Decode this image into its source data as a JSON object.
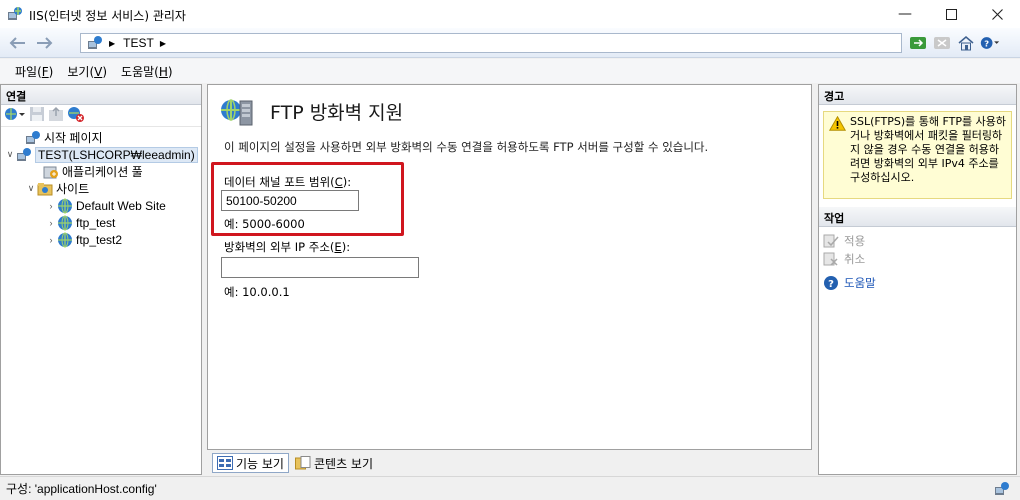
{
  "window": {
    "title": "IIS(인터넷 정보 서비스) 관리자"
  },
  "address": {
    "segments": [
      "TEST"
    ]
  },
  "menu": {
    "items": [
      {
        "label": "파일(",
        "key": "F",
        "end": ")"
      },
      {
        "label": "보기(",
        "key": "V",
        "end": ")"
      },
      {
        "label": "도움말(",
        "key": "H",
        "end": ")"
      }
    ]
  },
  "connections": {
    "header": "연결",
    "tree": [
      {
        "label": "시작 페이지"
      },
      {
        "label": "TEST(LSHCORP₩leeadmin)"
      },
      {
        "label": "애플리케이션 풀"
      },
      {
        "label": "사이트"
      },
      {
        "label": "Default Web Site"
      },
      {
        "label": "ftp_test"
      },
      {
        "label": "ftp_test2"
      }
    ]
  },
  "main": {
    "title": "FTP 방화벽 지원",
    "description": "이 페이지의 설정을 사용하면 외부 방화벽의 수동 연결을 허용하도록 FTP 서버를 구성할 수 있습니다.",
    "port_range": {
      "label": "데이터 채널 포트 범위(",
      "key": "C",
      "end": "):",
      "value": "50100-50200",
      "example": "예: 5000-6000"
    },
    "external_ip": {
      "label": "방화벽의 외부 IP 주소(",
      "key": "E",
      "end": "):",
      "value": "",
      "example": "예: 10.0.0.1"
    }
  },
  "tabs": {
    "features": "기능 보기",
    "content": "콘텐츠 보기"
  },
  "alerts": {
    "header": "경고",
    "message": "SSL(FTPS)를 통해 FTP를 사용하거나 방화벽에서 패킷을 필터링하지 않을 경우 수동 연결을 허용하려면 방화벽의 외부 IPv4 주소를 구성하십시오."
  },
  "actions": {
    "header": "작업",
    "apply": "적용",
    "cancel": "취소",
    "help": "도움말"
  },
  "status": {
    "text": "구성: 'applicationHost.config'"
  }
}
